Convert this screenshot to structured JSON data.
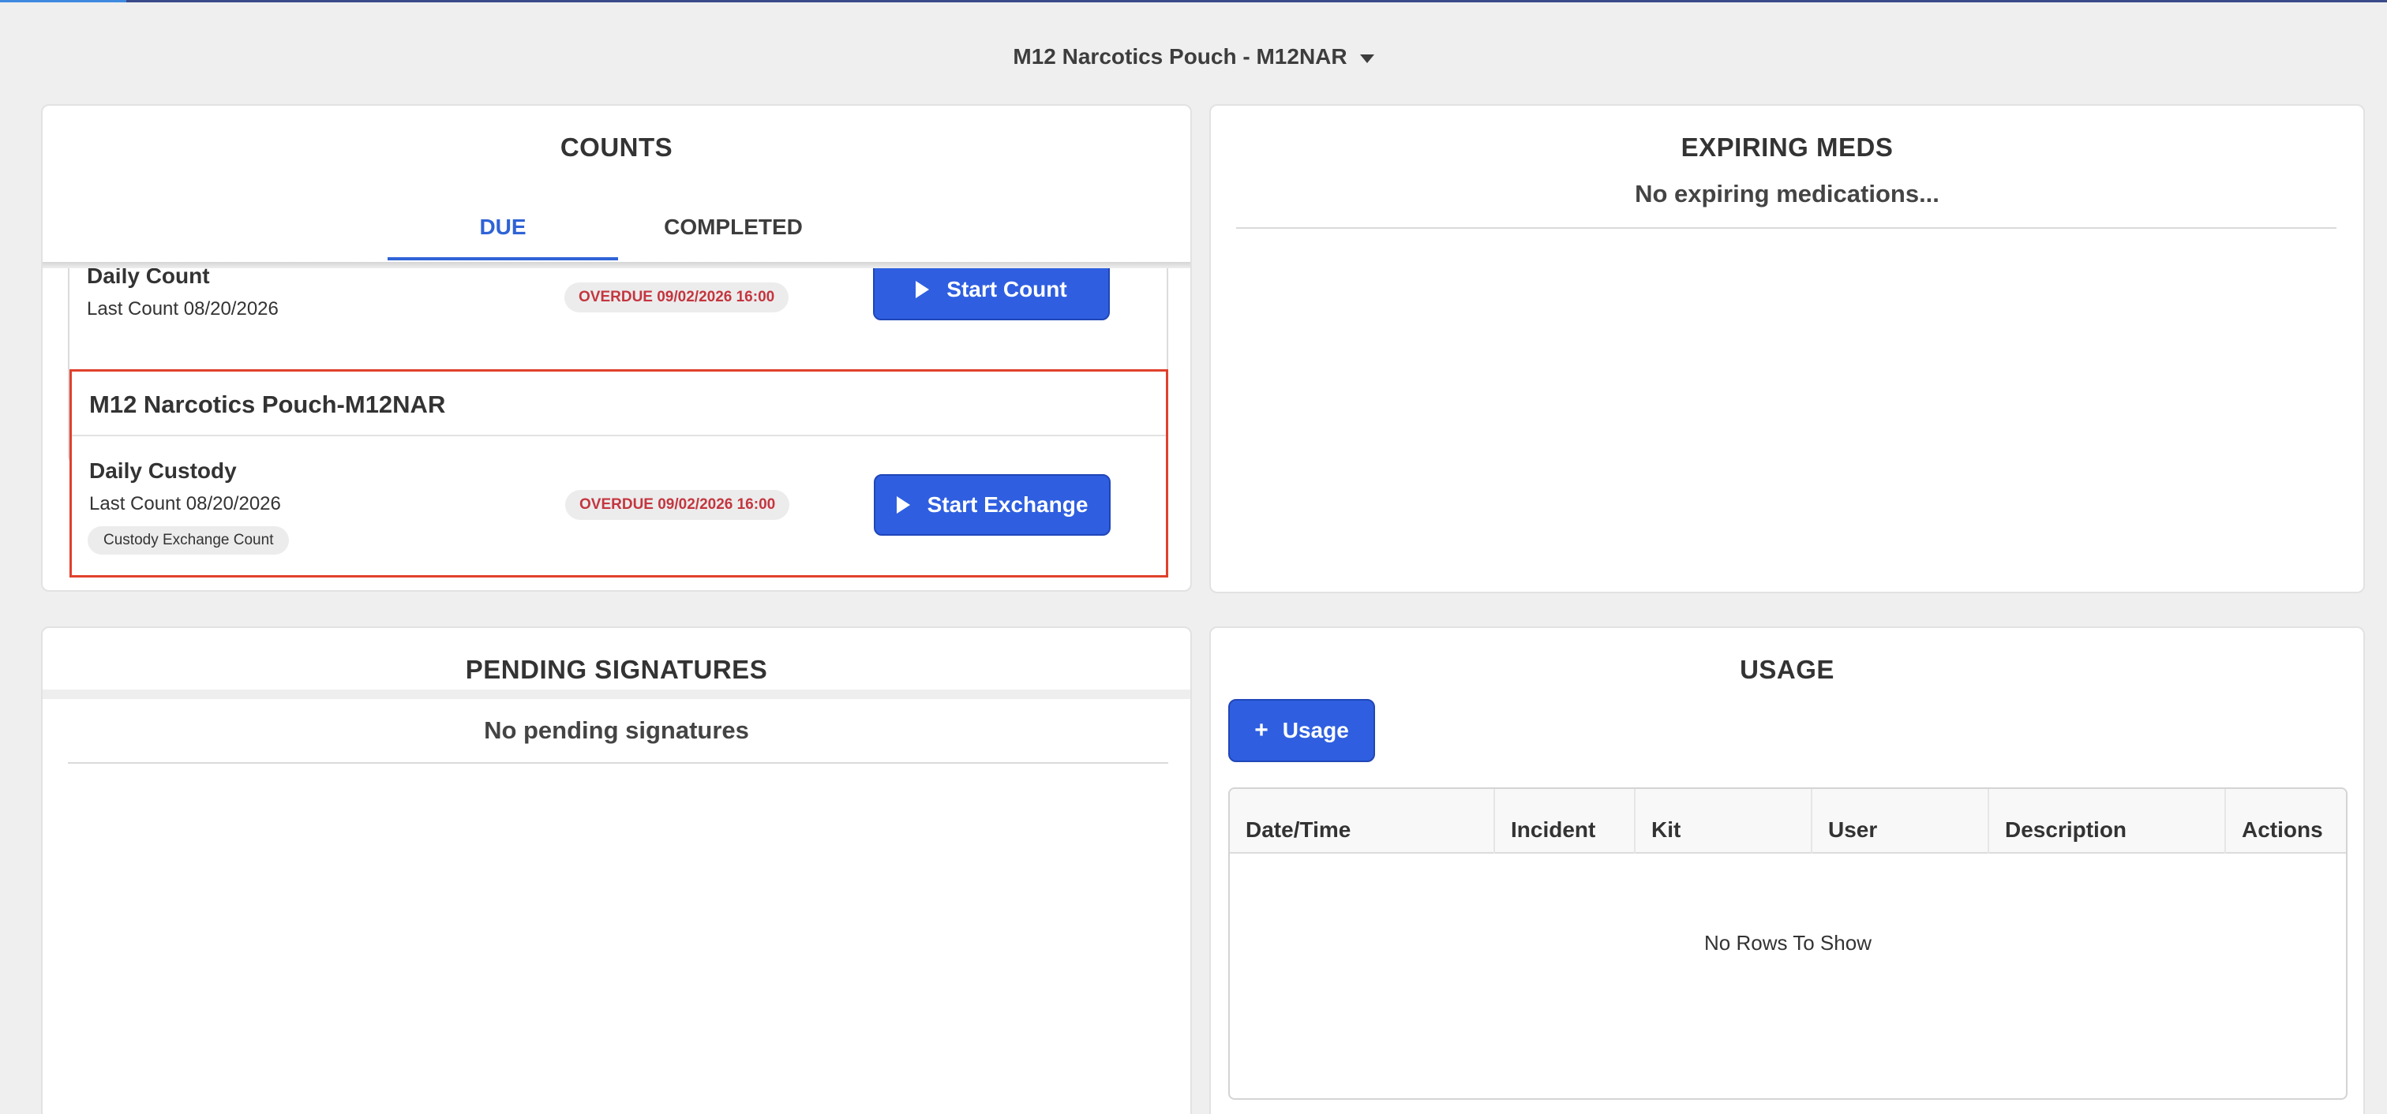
{
  "header": {
    "kit_selector_label": "M12 Narcotics Pouch - M12NAR"
  },
  "counts": {
    "title": "COUNTS",
    "tabs": [
      {
        "label": "DUE",
        "active": true
      },
      {
        "label": "COMPLETED",
        "active": false
      }
    ],
    "items": [
      {
        "name": "Daily Count",
        "last_count": "Last Count  08/20/2026",
        "status": "OVERDUE 09/02/2026 16:00",
        "action_label": "Start Count"
      }
    ],
    "group": {
      "title": "M12 Narcotics Pouch-M12NAR",
      "item": {
        "name": "Daily Custody",
        "last_count": "Last Count  08/20/2026",
        "chip": "Custody Exchange Count",
        "status": "OVERDUE 09/02/2026 16:00",
        "action_label": "Start Exchange"
      }
    }
  },
  "expiring": {
    "title": "EXPIRING MEDS",
    "empty_message": "No expiring medications..."
  },
  "pending": {
    "title": "PENDING SIGNATURES",
    "empty_message": "No pending signatures"
  },
  "usage": {
    "title": "USAGE",
    "add_button_label": "Usage",
    "columns": [
      "Date/Time",
      "Incident",
      "Kit",
      "User",
      "Description",
      "Actions"
    ],
    "rows": [],
    "empty_message": "No Rows To Show"
  },
  "colors": {
    "primary": "#2f5fe0",
    "overdue_text": "#c4363f",
    "highlight_border": "#e0402c",
    "page_background": "#efefef"
  },
  "icons": {
    "kit_selector": "caret-down-icon",
    "start_count": "play-icon",
    "start_exchange": "play-icon",
    "add_usage": "plus-icon"
  }
}
